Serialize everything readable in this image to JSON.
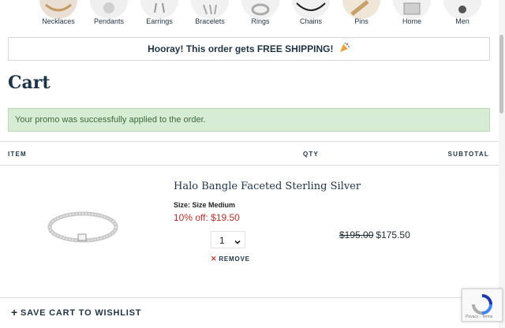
{
  "categories": [
    {
      "label": "Necklaces",
      "icon": "necklace-icon"
    },
    {
      "label": "Pendants",
      "icon": "pendant-icon"
    },
    {
      "label": "Earrings",
      "icon": "earrings-icon"
    },
    {
      "label": "Bracelets",
      "icon": "bracelet-icon"
    },
    {
      "label": "Rings",
      "icon": "ring-icon"
    },
    {
      "label": "Chains",
      "icon": "chain-icon"
    },
    {
      "label": "Pins",
      "icon": "pin-icon"
    },
    {
      "label": "Home",
      "icon": "home-icon"
    },
    {
      "label": "Men",
      "icon": "men-icon"
    }
  ],
  "shipping_banner": {
    "text": "Hooray! This order gets FREE SHIPPING!",
    "icon": "party-popper-icon"
  },
  "page_title": "Cart",
  "promo_message": "Your promo was successfully applied to the order.",
  "table_headers": {
    "item": "ITEM",
    "qty": "QTY",
    "subtotal": "SUBTOTAL"
  },
  "cart_item": {
    "name": "Halo Bangle Faceted Sterling Silver",
    "size": "Size: Size Medium",
    "discount": "10% off: $19.50",
    "quantity": "1",
    "remove_label": "REMOVE",
    "original_price": "$195.00",
    "sale_price": "$175.50"
  },
  "save_wishlist": "SAVE CART TO WISHLIST",
  "recaptcha_text": "Privacy - Terms",
  "colors": {
    "brand_navy": "#1d3348",
    "sale_red": "#b1332e",
    "promo_bg": "#d7ecd5",
    "promo_text": "#3e6a3b"
  }
}
